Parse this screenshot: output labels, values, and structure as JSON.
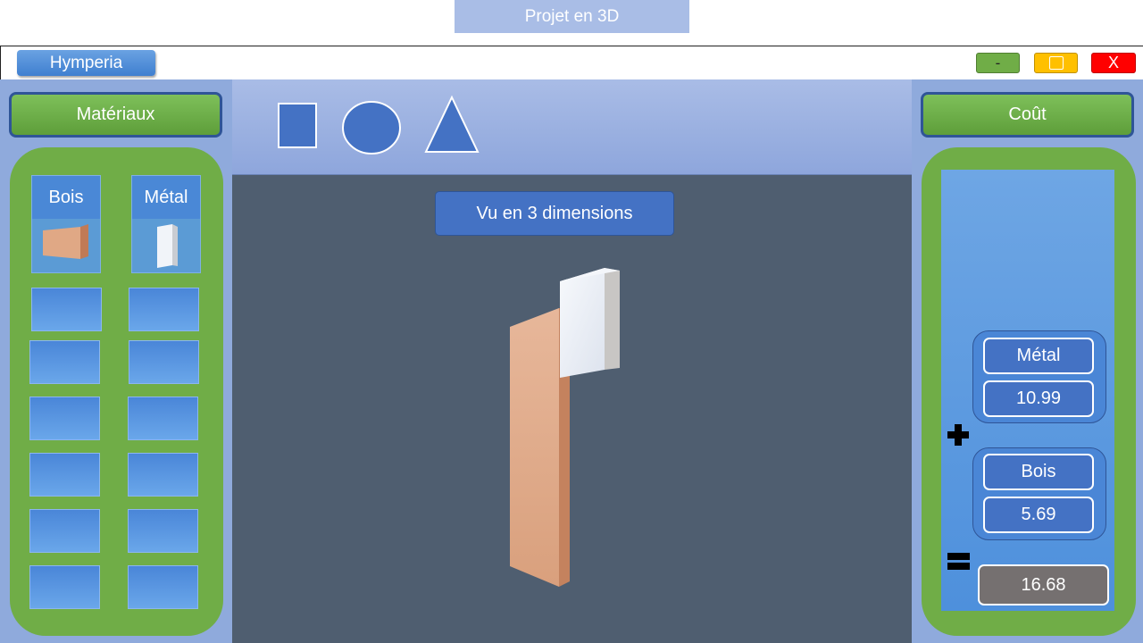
{
  "caption": "Projet en 3D",
  "app": {
    "name": "Hymperia"
  },
  "window_controls": {
    "minimize": "-",
    "close": "X"
  },
  "materials": {
    "header": "Matériaux",
    "items": [
      {
        "label": "Bois",
        "icon": "wood-block-icon",
        "color": "#d9a07a"
      },
      {
        "label": "Métal",
        "icon": "metal-block-icon",
        "color": "#e7ecf4"
      }
    ],
    "empty_slots": 12
  },
  "toolbar": {
    "shapes": [
      "square-shape-icon",
      "circle-shape-icon",
      "triangle-shape-icon"
    ]
  },
  "viewport": {
    "title": "Vu en 3 dimensions"
  },
  "cost": {
    "header": "Coût",
    "metal_label": "Métal",
    "metal_value": "10.99",
    "wood_label": "Bois",
    "wood_value": "5.69",
    "total": "16.68"
  },
  "colors": {
    "accent_blue": "#4472c4",
    "green": "#70ad47",
    "panel": "#8faadc",
    "viewport_bg": "#4f5e70"
  }
}
